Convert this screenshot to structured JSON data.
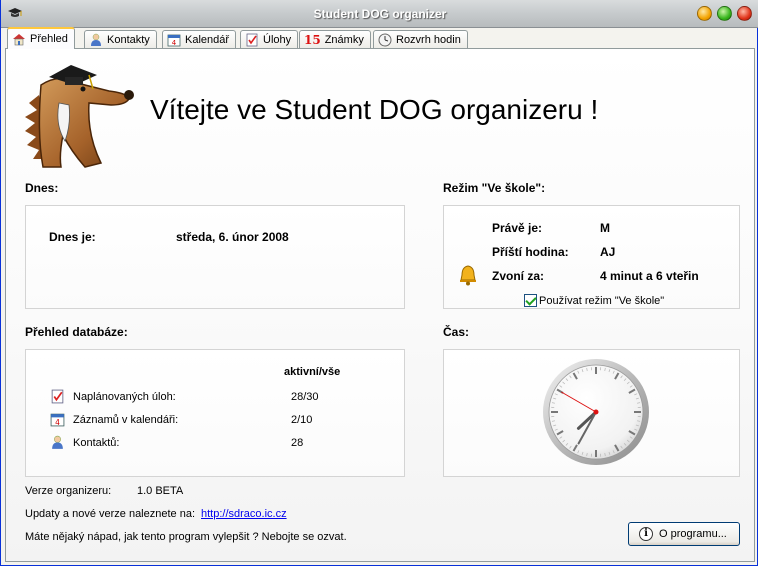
{
  "window": {
    "title": "Student DOG organizer"
  },
  "tabs": [
    {
      "label": "Přehled",
      "icon": "home-icon",
      "active": true
    },
    {
      "label": "Kontakty",
      "icon": "contact-person-icon"
    },
    {
      "label": "Kalendář",
      "icon": "calendar-icon"
    },
    {
      "label": "Úlohy",
      "icon": "task-check-icon"
    },
    {
      "label": "Známky",
      "icon": "grades-icon",
      "prefix": "15"
    },
    {
      "label": "Rozvrh hodin",
      "icon": "clock-icon"
    }
  ],
  "welcome": "Vítejte ve Student DOG organizeru !",
  "today": {
    "section": "Dnes:",
    "label": "Dnes je:",
    "value": "středa, 6. únor 2008"
  },
  "school_mode": {
    "section": "Režim \"Ve škole\":",
    "now_label": "Právě je:",
    "now_value": "M",
    "next_label": "Příští hodina:",
    "next_value": "AJ",
    "bell_label": "Zvoní za:",
    "bell_value": "4 minut a 6 vteřin",
    "checkbox_label": "Používat režim \"Ve škole\"",
    "checkbox_checked": true
  },
  "database": {
    "section": "Přehled databáze:",
    "column_header": "aktivní/vše",
    "rows": [
      {
        "label": "Naplánovaných úloh:",
        "value": "28/30",
        "icon": "task-check-icon"
      },
      {
        "label": "Záznamů v kalendáři:",
        "value": "2/10",
        "icon": "calendar-icon"
      },
      {
        "label": "Kontaktů:",
        "value": "28",
        "icon": "contact-person-icon"
      }
    ]
  },
  "time": {
    "section": "Čas:",
    "clock": {
      "hour": 7,
      "minute": 34,
      "second": 50
    }
  },
  "footer": {
    "version_label": "Verze organizeru:",
    "version_value": "1.0 BETA",
    "updates_text": "Updaty a nové verze naleznete na:",
    "updates_link": "http://sdraco.ic.cz",
    "idea_text": "Máte nějaký nápad, jak tento program vylepšit ? Nebojte se ozvat.",
    "about_button": "O programu..."
  },
  "colors": {
    "tab_active_accent": "#ffc83c",
    "link": "#0000ee",
    "checkbox_check": "#21a121"
  }
}
